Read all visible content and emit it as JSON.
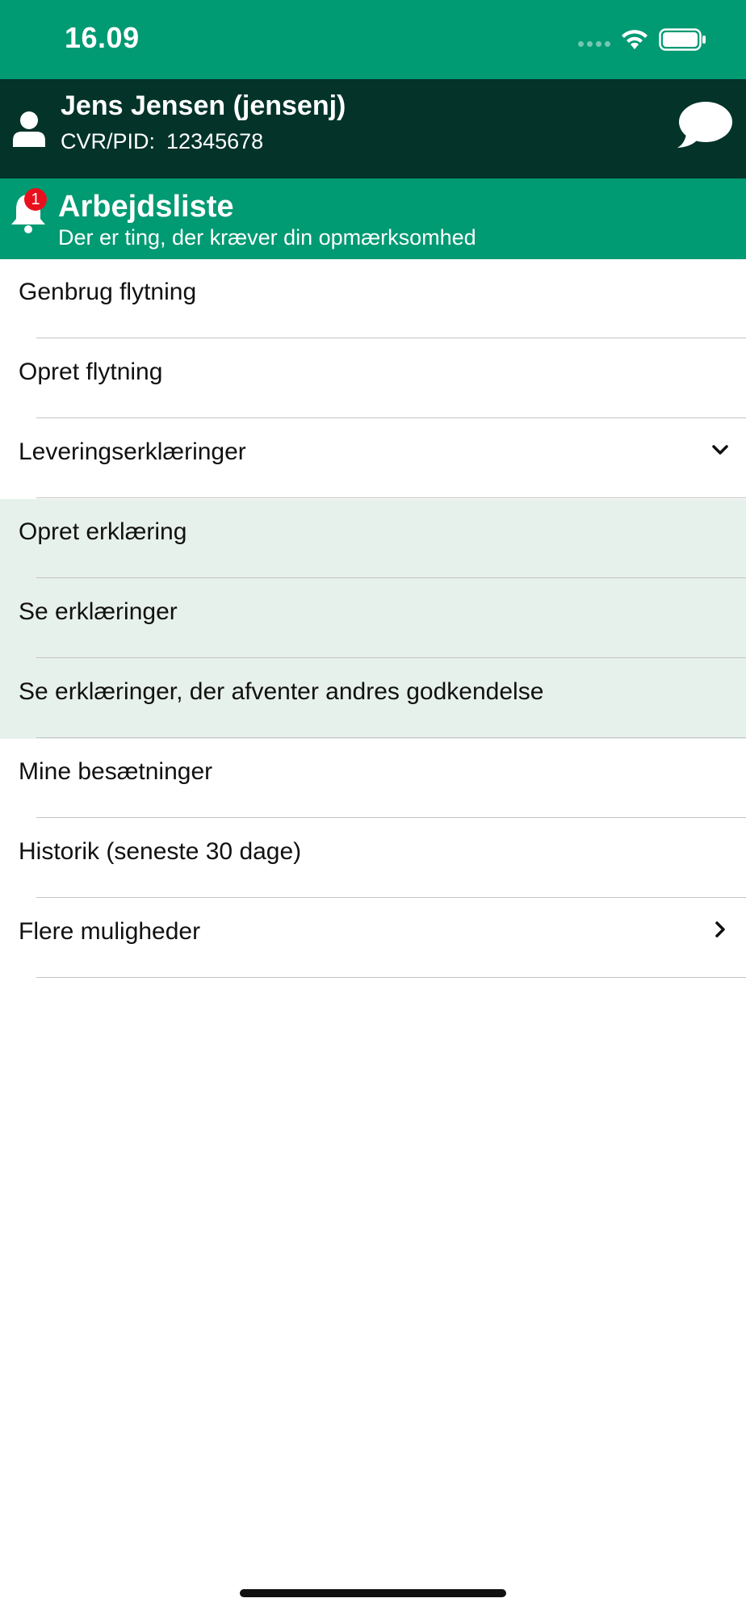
{
  "status_bar": {
    "time": "16.09"
  },
  "user": {
    "name": "Jens Jensen (jensenj)",
    "cvr_label": "CVR/PID:",
    "cvr_value": "12345678"
  },
  "worklist": {
    "badge_count": "1",
    "title": "Arbejdsliste",
    "subtitle": "Der er ting, der kræver din opmærksomhed"
  },
  "menu": {
    "items": [
      {
        "label": "Genbrug flytning",
        "icon": ""
      },
      {
        "label": "Opret flytning",
        "icon": ""
      },
      {
        "label": "Leveringserklæringer",
        "icon": "chevron-down-icon"
      },
      {
        "label": "Opret erklæring",
        "icon": "",
        "sub": true
      },
      {
        "label": "Se erklæringer",
        "icon": "",
        "sub": true
      },
      {
        "label": "Se erklæringer, der afventer andres godkendelse",
        "icon": "",
        "sub": true
      },
      {
        "label": "Mine besætninger",
        "icon": ""
      },
      {
        "label": "Historik (seneste 30 dage)",
        "icon": ""
      },
      {
        "label": "Flere muligheder",
        "icon": "chevron-right-icon"
      }
    ]
  },
  "colors": {
    "primary_green": "#009a73",
    "dark_green": "#033329",
    "submenu_bg": "#e7f1ec",
    "badge_red": "#e8101d"
  }
}
